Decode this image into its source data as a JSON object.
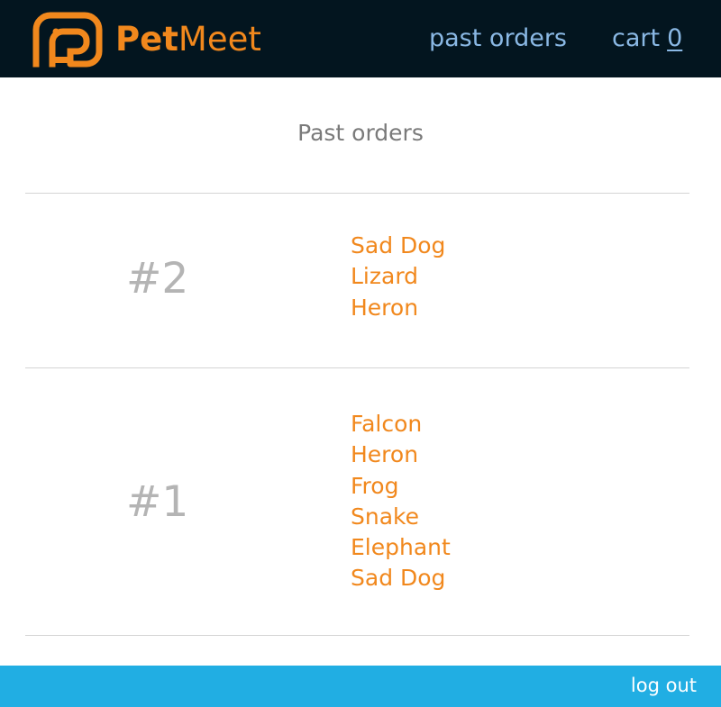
{
  "header": {
    "brand_bold": "Pet",
    "brand_light": "Meet",
    "nav": {
      "past_orders_label": "past orders",
      "cart_label": "cart",
      "cart_count": "0"
    }
  },
  "main": {
    "title": "Past orders",
    "orders": [
      {
        "number": "#2",
        "items": [
          "Sad Dog",
          "Lizard",
          "Heron"
        ]
      },
      {
        "number": "#1",
        "items": [
          "Falcon",
          "Heron",
          "Frog",
          "Snake",
          "Elephant",
          "Sad Dog"
        ]
      }
    ]
  },
  "footer": {
    "logout_label": "log out"
  },
  "colors": {
    "header_bg": "#03151f",
    "brand_orange": "#f1881d",
    "nav_blue": "#8ab8e4",
    "footer_bg": "#21aee3",
    "order_number_gray": "#b4b4b4"
  },
  "icons": {
    "logo": "elephant-logo-icon"
  }
}
